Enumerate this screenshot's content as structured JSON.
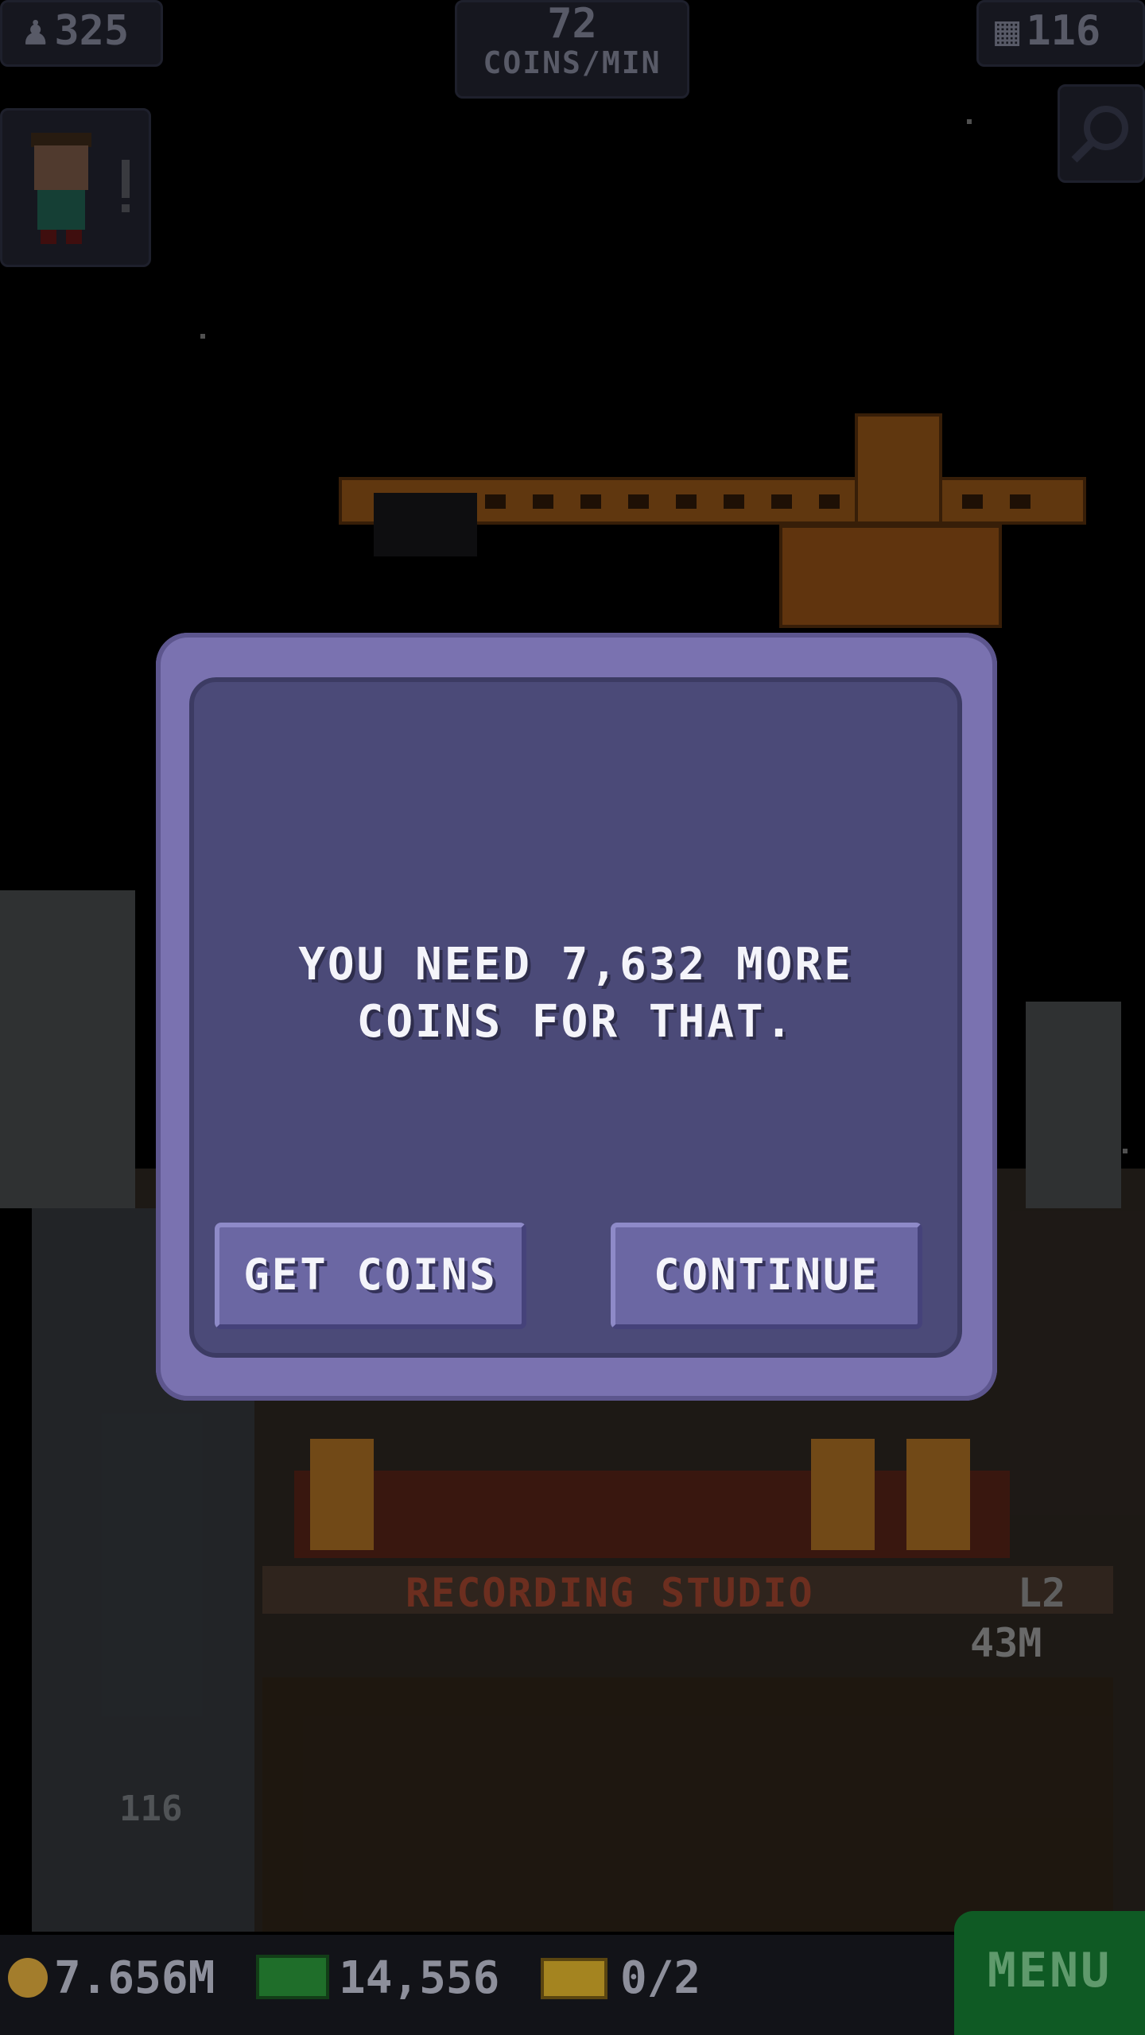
{
  "hud": {
    "population": "325",
    "coins_rate_value": "72",
    "coins_rate_label": "COINS/MIN",
    "floors": "116"
  },
  "dialog": {
    "message": "YOU NEED 7,632 MORE\nCOINS FOR THAT.",
    "get_coins_label": "GET COINS",
    "continue_label": "CONTINUE"
  },
  "tower": {
    "floor_name": "RECORDING STUDIO",
    "floor_level": "L2",
    "floor_value": "43M",
    "elevator_floor": "116"
  },
  "bottom_bar": {
    "coins": "7.656M",
    "bux": "14,556",
    "chests": "0/2",
    "menu_label": "MENU"
  },
  "colors": {
    "dialog_frame": "#7a72b0",
    "dialog_panel": "#4b4a78",
    "button": "#6b67a3",
    "menu_button": "#0f5a24"
  }
}
